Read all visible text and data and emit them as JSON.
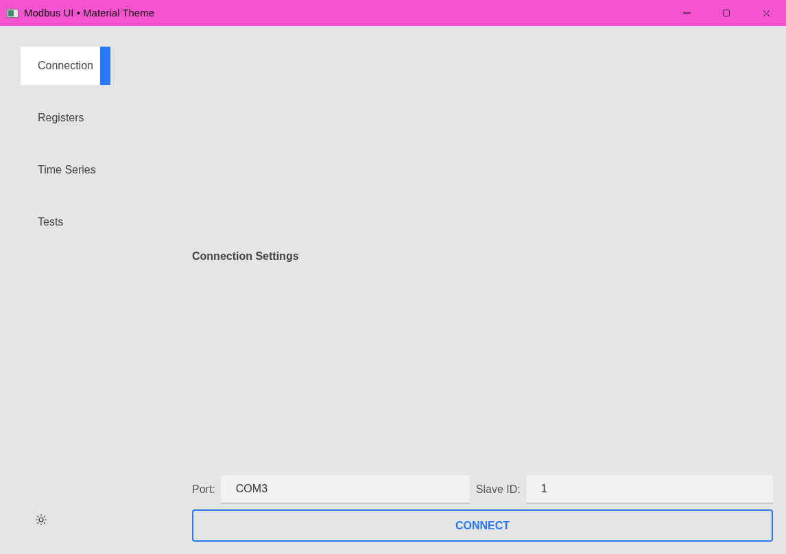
{
  "window": {
    "title": "Modbus UI • Material Theme"
  },
  "sidebar": {
    "items": [
      {
        "label": "Connection",
        "selected": true
      },
      {
        "label": "Registers",
        "selected": false
      },
      {
        "label": "Time Series",
        "selected": false
      },
      {
        "label": "Tests",
        "selected": false
      }
    ]
  },
  "main": {
    "heading": "Connection Settings",
    "port": {
      "label": "Port:",
      "value": "COM3"
    },
    "slave_id": {
      "label": "Slave ID:",
      "value": "1"
    },
    "connect_button": "CONNECT"
  }
}
